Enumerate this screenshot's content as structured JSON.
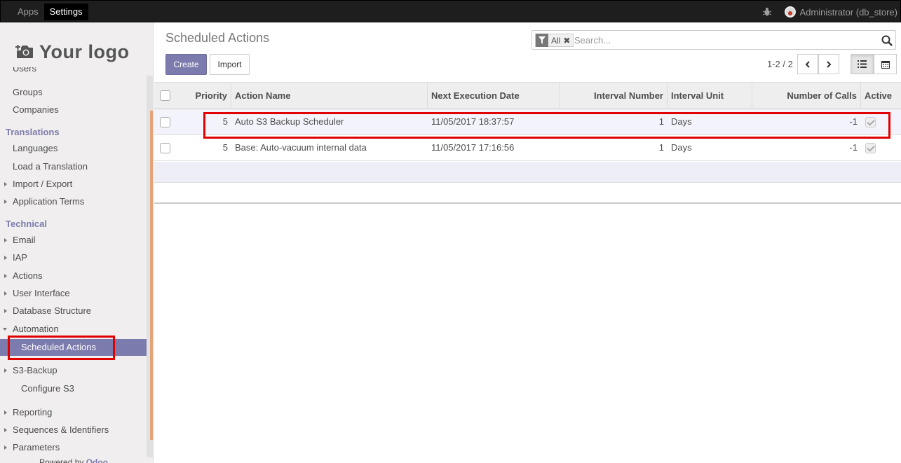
{
  "topbar": {
    "apps_label": "Apps",
    "settings_label": "Settings",
    "user_label": "Administrator (db_store)"
  },
  "sidebar": {
    "logo_text": "Your logo",
    "items_top": {
      "users": "Users",
      "groups": "Groups",
      "companies": "Companies"
    },
    "translations_header": "Translations",
    "translations": {
      "languages": "Languages",
      "load_translation": "Load a Translation",
      "import_export": "Import / Export",
      "application_terms": "Application Terms"
    },
    "technical_header": "Technical",
    "technical": {
      "email": "Email",
      "iap": "IAP",
      "actions": "Actions",
      "user_interface": "User Interface",
      "database_structure": "Database Structure",
      "automation": "Automation",
      "scheduled_actions": "Scheduled Actions",
      "s3_backup": "S3-Backup",
      "configure_s3": "Configure S3",
      "reporting": "Reporting",
      "sequences": "Sequences & Identifiers",
      "parameters": "Parameters"
    },
    "powered_by": "Powered by",
    "powered_brand": "Odoo"
  },
  "main": {
    "title": "Scheduled Actions",
    "search": {
      "facet": "All",
      "placeholder": "Search..."
    },
    "create_label": "Create",
    "import_label": "Import",
    "pager": "1-2 / 2"
  },
  "table": {
    "headers": {
      "priority": "Priority",
      "action_name": "Action Name",
      "next_execution": "Next Execution Date",
      "interval_number": "Interval Number",
      "interval_unit": "Interval Unit",
      "number_of_calls": "Number of Calls",
      "active": "Active"
    },
    "rows": [
      {
        "priority": "5",
        "action_name": "Auto S3 Backup Scheduler",
        "next_execution": "11/05/2017 18:37:57",
        "interval_number": "1",
        "interval_unit": "Days",
        "number_of_calls": "-1",
        "active": true
      },
      {
        "priority": "5",
        "action_name": "Base: Auto-vacuum internal data",
        "next_execution": "11/05/2017 17:16:56",
        "interval_number": "1",
        "interval_unit": "Days",
        "number_of_calls": "-1",
        "active": true
      }
    ]
  },
  "colors": {
    "brand": "#7c7bad",
    "highlight": "#e00000",
    "topbar": "#1e1e1e"
  }
}
